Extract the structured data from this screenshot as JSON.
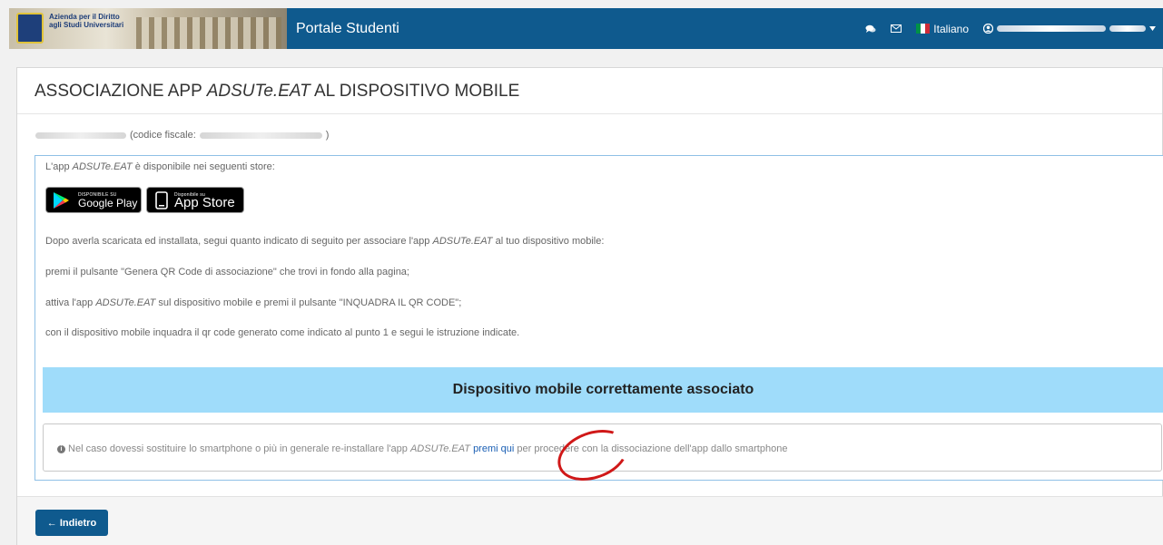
{
  "header": {
    "logo_text": "Azienda per il Diritto\nagli Studi Universitari",
    "title": "Portale Studenti",
    "language": "Italiano",
    "icons": [
      "chat-icon",
      "envelope-icon",
      "flag-italy-icon",
      "user-icon",
      "caret-down-icon"
    ],
    "flag_colors": [
      "#009246",
      "#ffffff",
      "#ce2b37"
    ],
    "brand_color": "#0f5a8e"
  },
  "page": {
    "title_prefix": "ASSOCIAZIONE APP ",
    "title_app": "ADSUTe.EAT",
    "title_suffix": " AL DISPOSITIVO MOBILE",
    "fiscal_code_label": "(codice fiscale:",
    "fiscal_code_close": ")"
  },
  "instructions": {
    "store_line_prefix": "L'app ",
    "app_name": "ADSUTe.EAT",
    "store_line_suffix": " è disponibile nei seguenti store:",
    "google_play_small": "DISPONIBILE SU",
    "google_play_big": "Google Play",
    "app_store_small": "Disponibile su",
    "app_store_big": "App Store",
    "line_intro_prefix": "Dopo averla scaricata ed installata, segui quanto indicato di seguito per associare l'app ",
    "line_intro_suffix": " al tuo dispositivo mobile:",
    "step1": "premi il pulsante \"Genera QR Code di associazione\" che trovi in fondo alla pagina;",
    "step2_prefix": "attiva l'app ",
    "step2_suffix": " sul dispositivo mobile e premi il pulsante \"INQUADRA IL QR CODE\";",
    "step3": "con il dispositivo mobile inquadra il qr code generato come indicato al punto 1 e segui le istruzione indicate."
  },
  "status": {
    "success_message": "Dispositivo mobile correttamente associato",
    "success_color": "#9fdcfa"
  },
  "note": {
    "prefix": " Nel caso dovessi sostituire lo smartphone o più in generale re-installare l'app ",
    "link": "premi qui",
    "suffix": " per procedere con la dissociazione dell'app dallo smartphone",
    "highlight_color": "#d01818"
  },
  "footer": {
    "back_label": "← Indietro"
  }
}
